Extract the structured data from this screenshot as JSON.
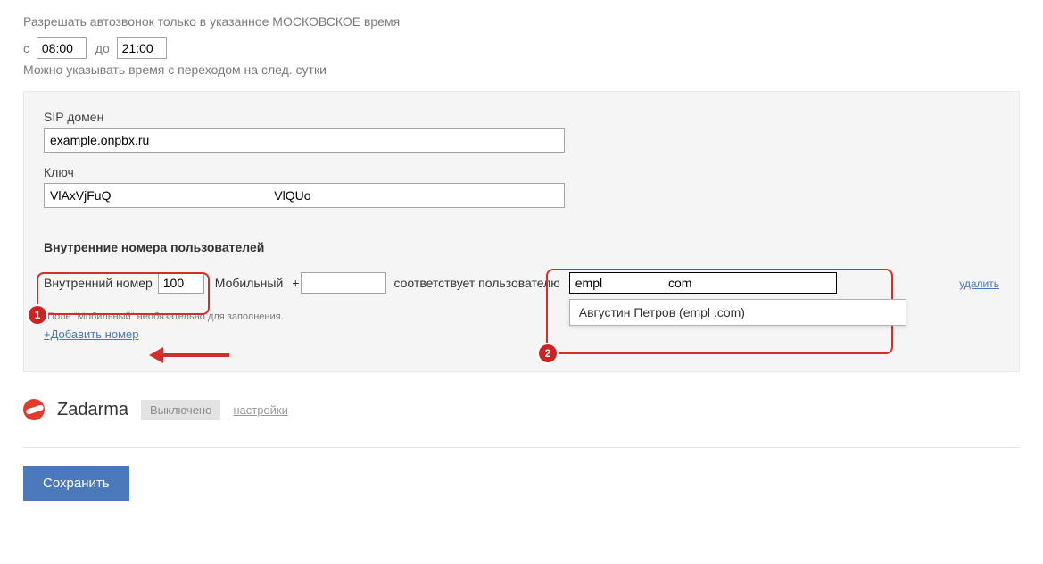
{
  "autocall": {
    "title": "Разрешать автозвонок только в указанное МОСКОВСКОЕ время",
    "from_label": "с",
    "from_value": "08:00",
    "to_label": "до",
    "to_value": "21:00",
    "hint": "Можно указывать время с переходом на след. сутки"
  },
  "sip": {
    "domain_label": "SIP домен",
    "domain_value": "example.onpbx.ru",
    "key_label": "Ключ",
    "key_value": "VlAxVjFuQ                                               VlQUo"
  },
  "extensions": {
    "title": "Внутренние номера пользователей",
    "number_label": "Внутренний номер",
    "number_value": "100",
    "mobile_label": "Мобильный",
    "mobile_prefix": "+",
    "mobile_value": "",
    "match_label": "соответствует пользователю",
    "user_search_value": "empl                   com",
    "dropdown_option": "Августин Петров (empl                  .com)",
    "delete": "удалить",
    "note": "*Поле \"Мобильный\" необязательно для заполнения.",
    "add_link": "+Добавить номер"
  },
  "annotations": {
    "num1": "1",
    "num2": "2"
  },
  "provider": {
    "name": "Zadarma",
    "status": "Выключено",
    "settings": "настройки"
  },
  "save_button": "Сохранить"
}
